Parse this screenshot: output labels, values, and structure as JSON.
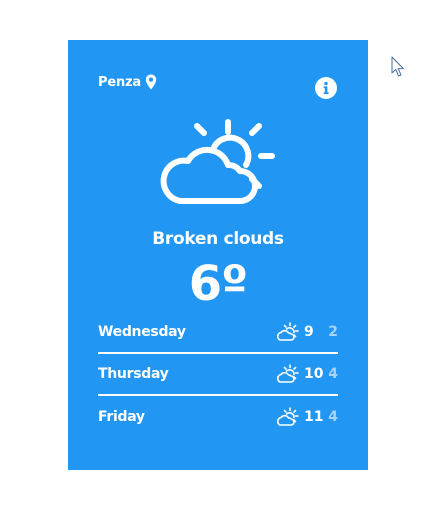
{
  "location": {
    "city": "Penza",
    "pin_icon": "map-pin-icon"
  },
  "info_icon": "info-icon",
  "current": {
    "icon": "partly-cloudy-icon",
    "condition": "Broken clouds",
    "temperature": "6º"
  },
  "forecast": [
    {
      "day": "Wednesday",
      "icon": "partly-cloudy-icon",
      "high": "9",
      "low": "2"
    },
    {
      "day": "Thursday",
      "icon": "partly-cloudy-icon",
      "high": "10",
      "low": "4"
    },
    {
      "day": "Friday",
      "icon": "partly-cloudy-icon",
      "high": "11",
      "low": "4"
    }
  ],
  "colors": {
    "card_background": "#2196f3",
    "text": "#ffffff",
    "low_temp": "#a9d3fb"
  }
}
